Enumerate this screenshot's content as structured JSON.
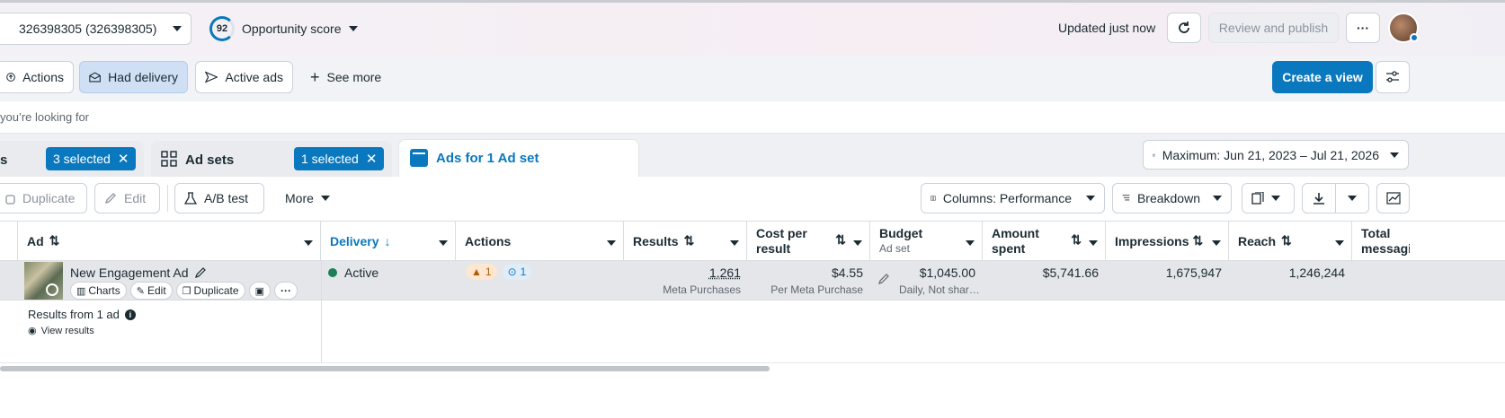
{
  "top": {
    "account_label": "326398305 (326398305)",
    "opportunity_score": "92",
    "opportunity_label": "Opportunity score",
    "updated_text": "Updated just now",
    "review_publish": "Review and publish"
  },
  "filters": {
    "actions": "Actions",
    "had_delivery": "Had delivery",
    "active_ads": "Active ads",
    "see_more": "See more",
    "create_view": "Create a view"
  },
  "search": {
    "placeholder_text": "you’re looking for"
  },
  "levels": {
    "campaigns_partial": "s",
    "campaigns_selected": "3 selected",
    "adsets_label": "Ad sets",
    "adsets_selected": "1 selected",
    "ads_label": "Ads for 1 Ad set",
    "date_range": "Maximum: Jun 21, 2023 – Jul 21, 2026"
  },
  "toolbar": {
    "duplicate": "Duplicate",
    "edit": "Edit",
    "ab_test": "A/B test",
    "more": "More",
    "columns": "Columns: Performance",
    "breakdown": "Breakdown"
  },
  "table": {
    "headers": {
      "ad": "Ad",
      "delivery": "Delivery",
      "actions": "Actions",
      "results": "Results",
      "cost_per_result_1": "Cost per",
      "cost_per_result_2": "result",
      "budget": "Budget",
      "budget_sub": "Ad set",
      "amount_spent_1": "Amount",
      "amount_spent_2": "spent",
      "impressions": "Impressions",
      "reach": "Reach",
      "total_messaging": "Total messagin"
    },
    "row": {
      "name": "New Engagement Ad",
      "charts": "Charts",
      "edit": "Edit",
      "duplicate": "Duplicate",
      "delivery": "Active",
      "warn_count": "1",
      "info_count": "1",
      "results": "1,261",
      "results_sub": "Meta Purchases",
      "cost": "$4.55",
      "cost_sub": "Per Meta Purchase",
      "budget": "$1,045.00",
      "budget_sub": "Daily, Not shar…",
      "amount_spent": "$5,741.66",
      "impressions": "1,675,947",
      "reach": "1,246,244"
    },
    "summary": {
      "label": "Results from 1 ad",
      "view_results": "View results"
    }
  },
  "colors": {
    "accent": "#0a78be",
    "active_dot": "#1a7f5a",
    "warn": "#e07b00"
  }
}
